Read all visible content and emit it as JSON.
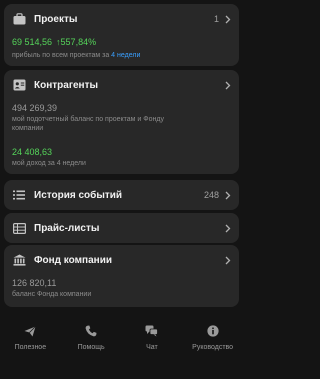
{
  "projects": {
    "title": "Проекты",
    "count": "1",
    "amount": "69 514,56",
    "growth": "↑557,84%",
    "desc_prefix": "прибыль по всем проектам за ",
    "desc_link": "4 недели"
  },
  "counterparties": {
    "title": "Контрагенты",
    "balance": "494 269,39",
    "balance_desc": "мой подотчетный баланс по проектам и Фонду компании",
    "income": "24 408,63",
    "income_desc": "мой доход за 4 недели"
  },
  "history": {
    "title": "История событий",
    "count": "248"
  },
  "pricelists": {
    "title": "Прайс-листы"
  },
  "fund": {
    "title": "Фонд компании",
    "balance": "126 820,11",
    "balance_desc": "баланс Фонда компании"
  },
  "tabs": [
    {
      "label": "Полезное",
      "icon": "paper-plane-icon"
    },
    {
      "label": "Помощь",
      "icon": "phone-icon"
    },
    {
      "label": "Чат",
      "icon": "chat-bubbles-icon"
    },
    {
      "label": "Руководство",
      "icon": "info-icon"
    }
  ],
  "colors": {
    "background": "#141414",
    "card": "#282828",
    "positive": "#55d45a",
    "link": "#3aa0ff"
  }
}
